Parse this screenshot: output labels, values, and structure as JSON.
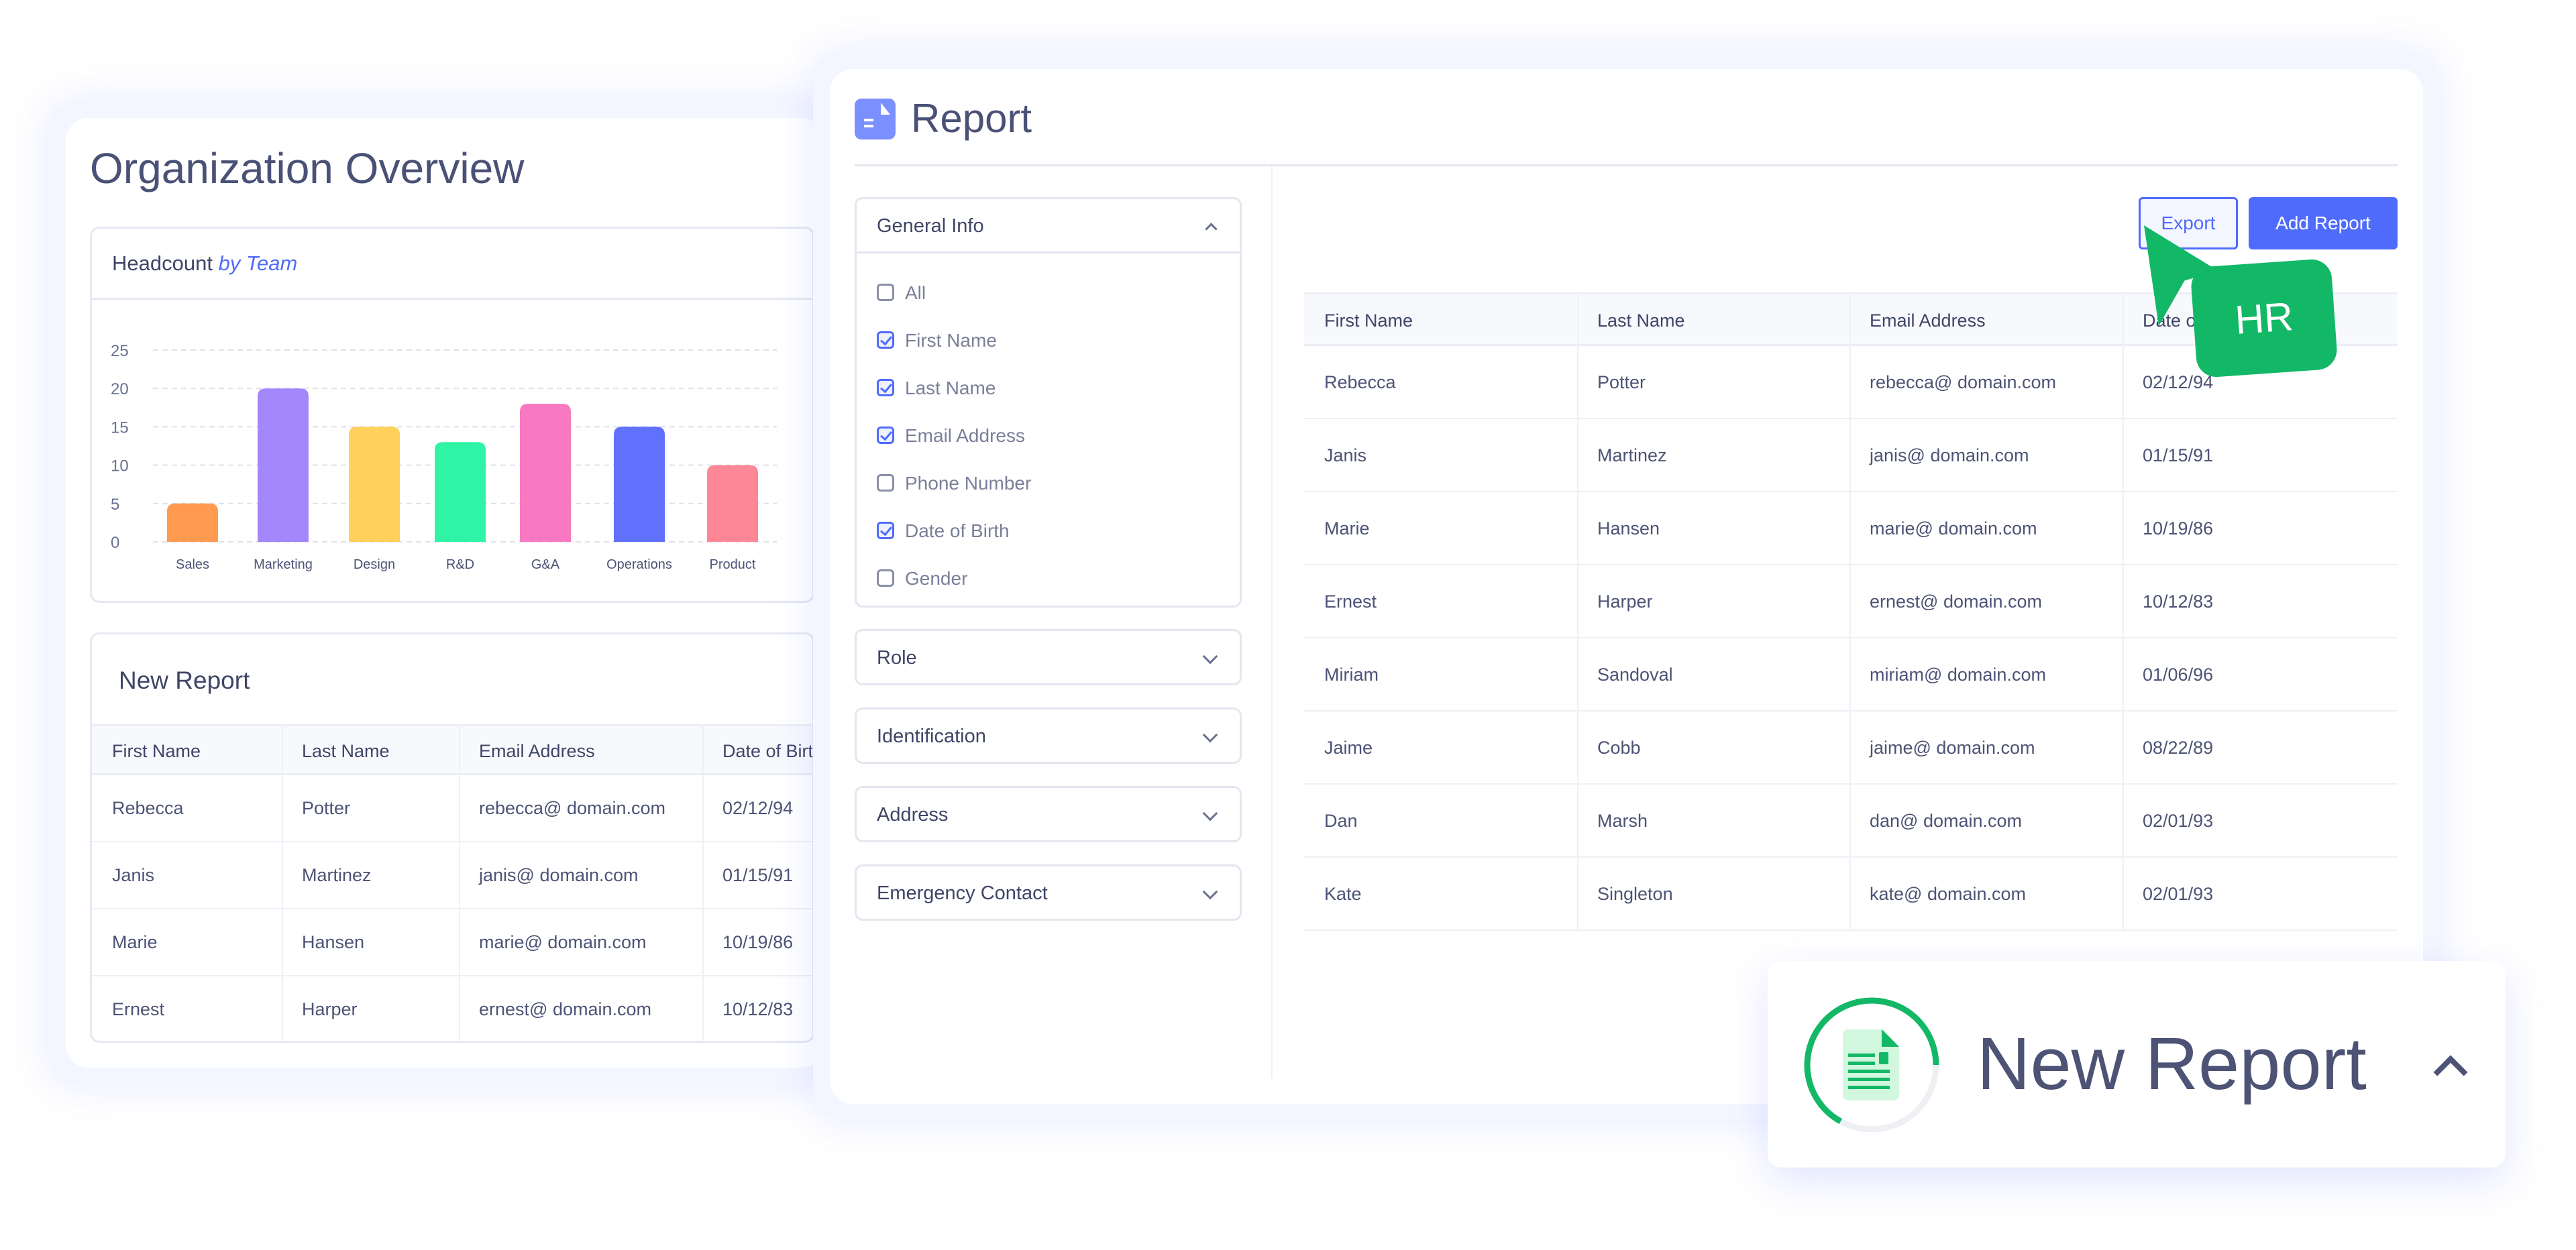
{
  "overview": {
    "title": "Organization Overview",
    "headcount": {
      "title": "Headcount",
      "title_em": "by Team"
    },
    "new_report": {
      "title": "New Report",
      "columns": [
        "First Name",
        "Last Name",
        "Email Address",
        "Date of Birth"
      ],
      "rows": [
        [
          "Rebecca",
          "Potter",
          "rebecca@ domain.com",
          "02/12/94"
        ],
        [
          "Janis",
          "Martinez",
          "janis@ domain.com",
          "01/15/91"
        ],
        [
          "Marie",
          "Hansen",
          "marie@ domain.com",
          "10/19/86"
        ],
        [
          "Ernest",
          "Harper",
          "ernest@ domain.com",
          "10/12/83"
        ]
      ]
    }
  },
  "chart_data": {
    "type": "bar",
    "title": "Headcount by Team",
    "categories": [
      "Sales",
      "Marketing",
      "Design",
      "R&D",
      "G&A",
      "Operations",
      "Product"
    ],
    "values": [
      5,
      20,
      15,
      13,
      18,
      15,
      10
    ],
    "ylim": [
      0,
      25
    ],
    "yticks": [
      0,
      5,
      10,
      15,
      20,
      25
    ],
    "grid": true,
    "colors": [
      "#ff9a4f",
      "#a487fb",
      "#ffd05a",
      "#2ff4a6",
      "#f878c1",
      "#5f71fd",
      "#fe8797"
    ]
  },
  "report": {
    "title": "Report",
    "icon": "document-icon",
    "export_label": "Export",
    "add_label": "Add Report",
    "general_info": {
      "label": "General Info",
      "expanded": true,
      "options": [
        {
          "label": "All",
          "checked": false
        },
        {
          "label": "First Name",
          "checked": true
        },
        {
          "label": "Last Name",
          "checked": true
        },
        {
          "label": "Email Address",
          "checked": true
        },
        {
          "label": "Phone Number",
          "checked": false
        },
        {
          "label": "Date of Birth",
          "checked": true
        },
        {
          "label": "Gender",
          "checked": false
        }
      ]
    },
    "sections": [
      "Role",
      "Identification",
      "Address",
      "Emergency Contact"
    ],
    "columns": [
      "First Name",
      "Last Name",
      "Email Address",
      "Date of Birth"
    ],
    "rows": [
      [
        "Rebecca",
        "Potter",
        "rebecca@ domain.com",
        "02/12/94"
      ],
      [
        "Janis",
        "Martinez",
        "janis@ domain.com",
        "01/15/91"
      ],
      [
        "Marie",
        "Hansen",
        "marie@ domain.com",
        "10/19/86"
      ],
      [
        "Ernest",
        "Harper",
        "ernest@ domain.com",
        "10/12/83"
      ],
      [
        "Miriam",
        "Sandoval",
        "miriam@ domain.com",
        "01/06/96"
      ],
      [
        "Jaime",
        "Cobb",
        "jaime@ domain.com",
        "08/22/89"
      ],
      [
        "Dan",
        "Marsh",
        "dan@ domain.com",
        "02/01/93"
      ],
      [
        "Kate",
        "Singleton",
        "kate@ domain.com",
        "02/01/93"
      ]
    ]
  },
  "cursor": {
    "label": "HR",
    "color": "#13b866"
  },
  "toast": {
    "label": "New Report",
    "progress": 0.67,
    "color": "#13b866"
  },
  "colors": {
    "accent": "#4f6bfb",
    "text": "#4d5375"
  }
}
